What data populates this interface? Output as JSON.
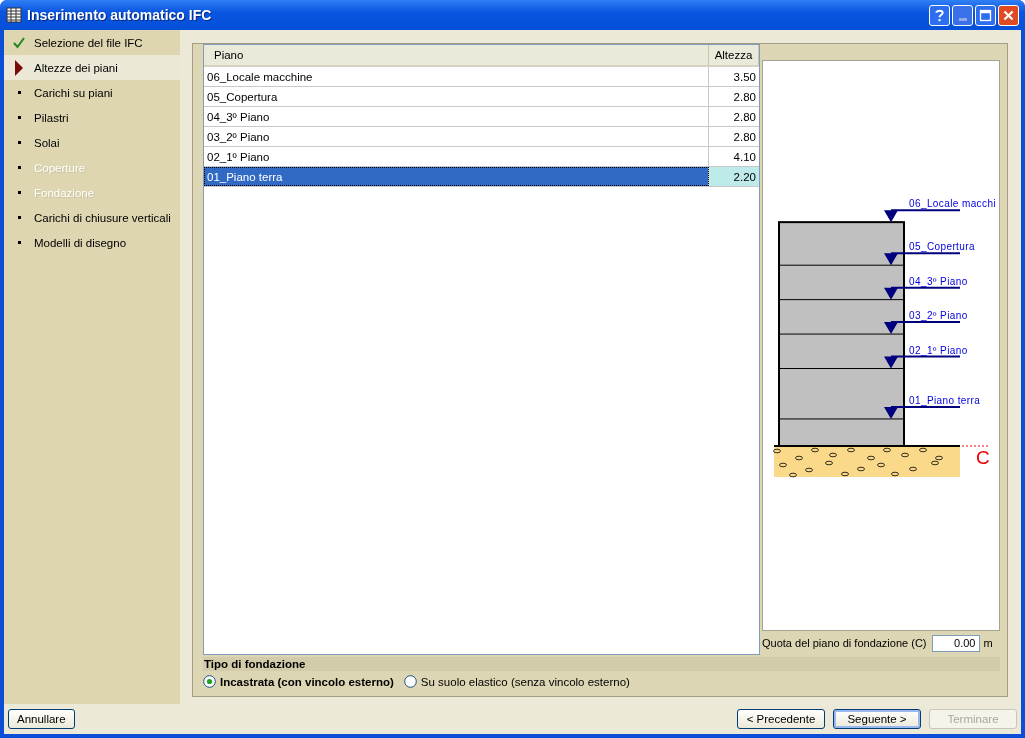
{
  "window": {
    "title": "Inserimento automatico IFC"
  },
  "steps": [
    {
      "label": "Selezione del file IFC",
      "kind": "done",
      "selected": false,
      "disabled": false
    },
    {
      "label": "Altezze dei piani",
      "kind": "current",
      "selected": true,
      "disabled": false
    },
    {
      "label": "Carichi su piani",
      "kind": "pending",
      "selected": false,
      "disabled": false
    },
    {
      "label": "Pilastri",
      "kind": "pending",
      "selected": false,
      "disabled": false
    },
    {
      "label": "Solai",
      "kind": "pending",
      "selected": false,
      "disabled": false
    },
    {
      "label": "Coperture",
      "kind": "pending",
      "selected": false,
      "disabled": true
    },
    {
      "label": "Fondazione",
      "kind": "pending",
      "selected": false,
      "disabled": true
    },
    {
      "label": "Carichi di chiusure verticali",
      "kind": "pending",
      "selected": false,
      "disabled": false
    },
    {
      "label": "Modelli di disegno",
      "kind": "pending",
      "selected": false,
      "disabled": false
    }
  ],
  "table": {
    "columns": [
      "Piano",
      "Altezza"
    ],
    "rows": [
      {
        "piano": "06_Locale macchine",
        "altezza": "3.50",
        "selected": false
      },
      {
        "piano": "05_Copertura",
        "altezza": "2.80",
        "selected": false
      },
      {
        "piano": "04_3º Piano",
        "altezza": "2.80",
        "selected": false
      },
      {
        "piano": "03_2º Piano",
        "altezza": "2.80",
        "selected": false
      },
      {
        "piano": "02_1º Piano",
        "altezza": "4.10",
        "selected": false
      },
      {
        "piano": "01_Piano terra",
        "altezza": "2.20",
        "selected": true
      }
    ]
  },
  "drawing": {
    "levels": [
      "06_Locale macchi",
      "05_Copertura",
      "04_3º Piano",
      "03_2º Piano",
      "02_1º Piano",
      "01_Piano terra"
    ],
    "foundation_mark": "C"
  },
  "foundation_level": {
    "label": "Quota del piano di fondazione (C)",
    "value": "0.00",
    "unit": "m"
  },
  "foundation_type": {
    "title": "Tipo di fondazione",
    "options": [
      {
        "label": "Incastrata (con vincolo esterno)",
        "selected": true
      },
      {
        "label": "Su suolo elastico (senza vincolo esterno)",
        "selected": false
      }
    ]
  },
  "buttons": [
    {
      "label": "Annullare",
      "kind": "cancel",
      "disabled": false,
      "default": false
    },
    {
      "label": "< Precedente",
      "kind": "nav",
      "disabled": false,
      "default": false
    },
    {
      "label": "Seguente >",
      "kind": "nav",
      "disabled": false,
      "default": true
    },
    {
      "label": "Terminare",
      "kind": "nav",
      "disabled": true,
      "default": false
    }
  ]
}
